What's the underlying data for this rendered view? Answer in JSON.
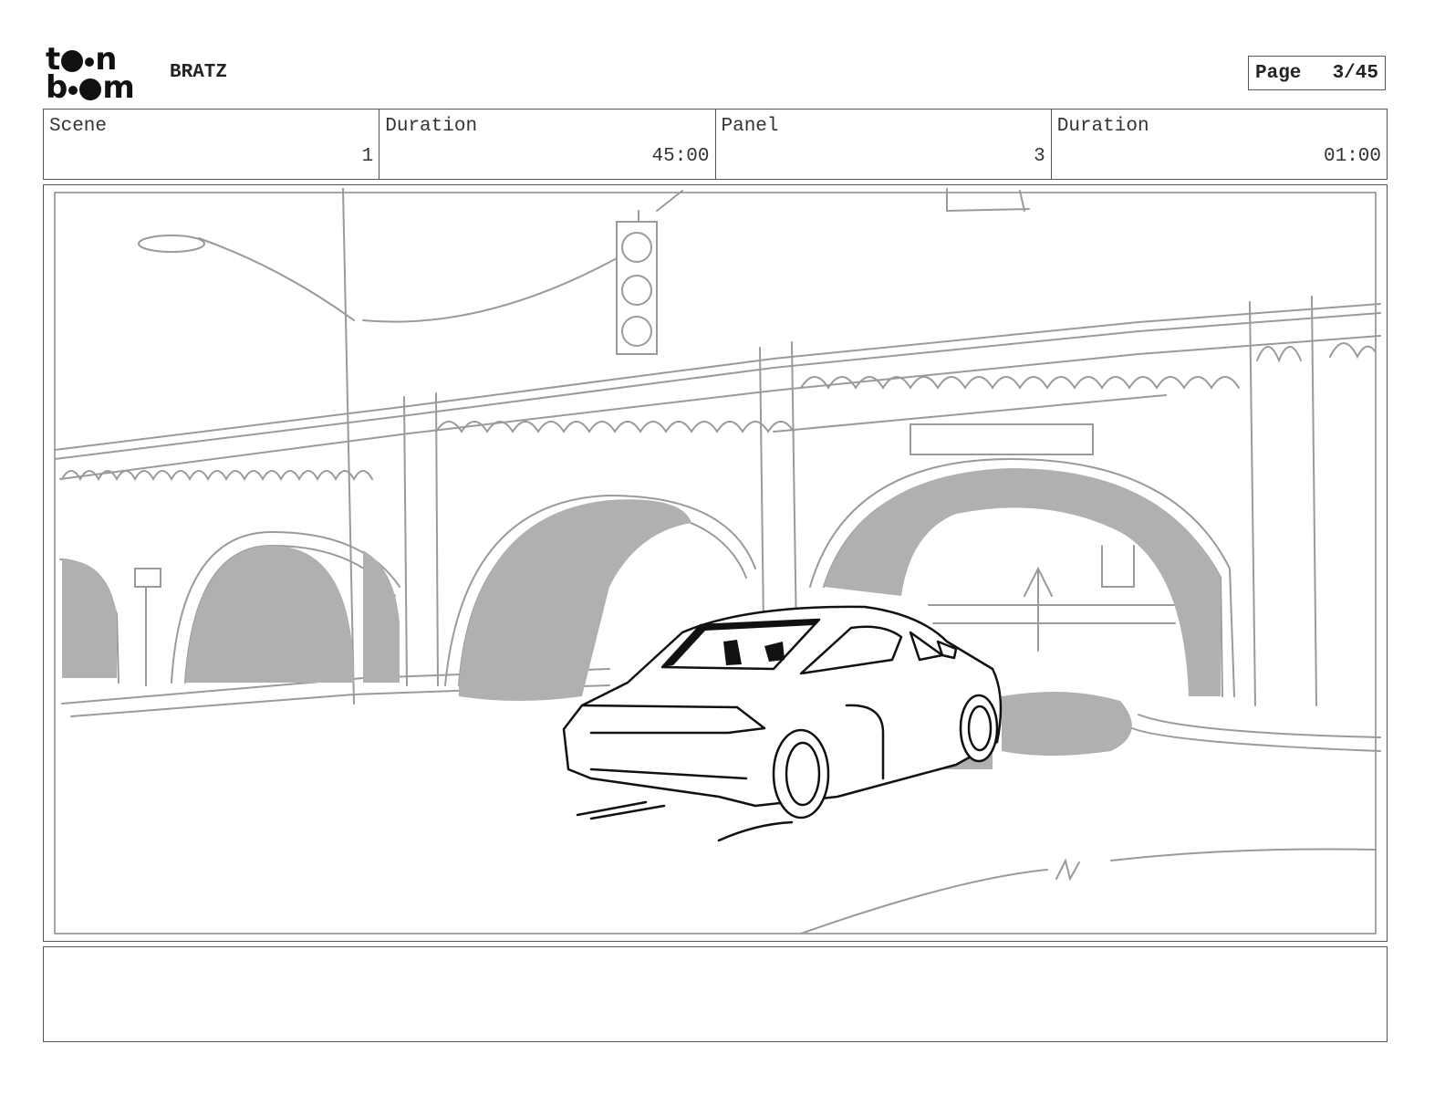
{
  "header": {
    "logo_text": "toon boom",
    "project": "BRATZ",
    "page_label": "Page",
    "page_value": "3/45"
  },
  "info": {
    "scene_label": "Scene",
    "scene_value": "1",
    "scene_duration_label": "Duration",
    "scene_duration_value": "45:00",
    "panel_label": "Panel",
    "panel_value": "3",
    "panel_duration_label": "Duration",
    "panel_duration_value": "01:00"
  },
  "notes": {
    "text": ""
  }
}
